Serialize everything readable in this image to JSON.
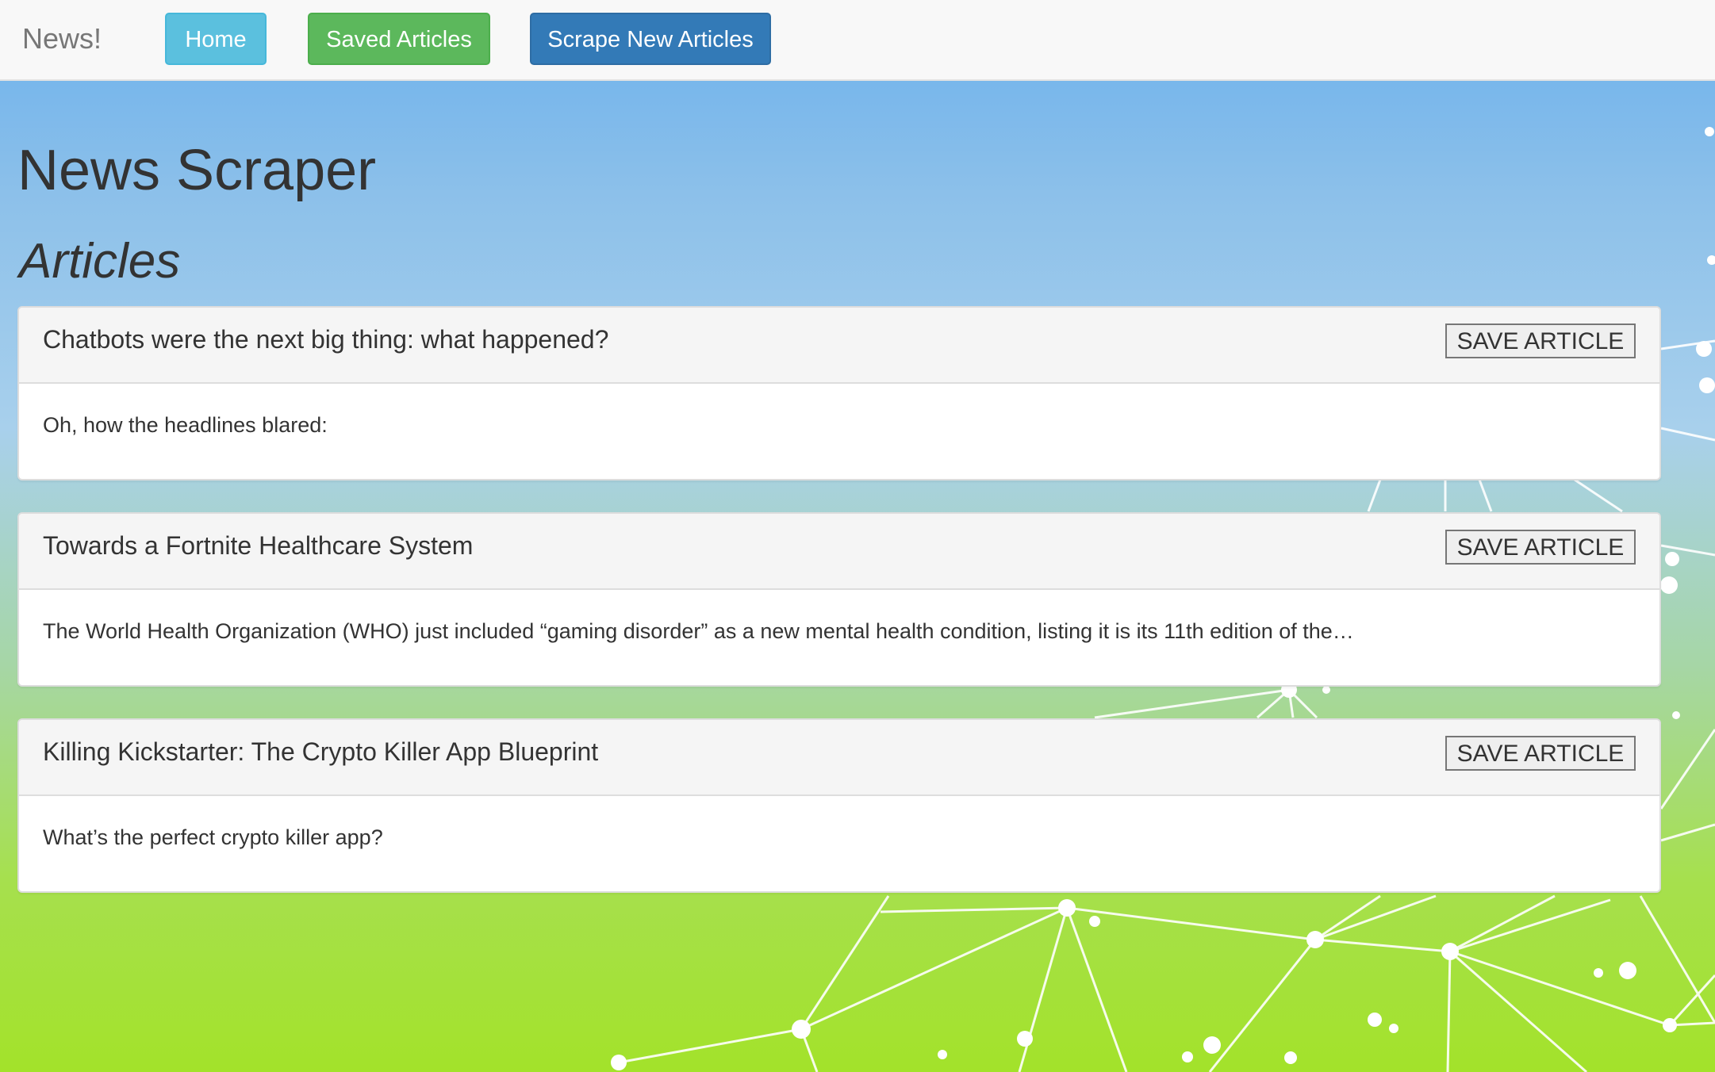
{
  "navbar": {
    "brand": "News!",
    "buttons": [
      {
        "label": "Home"
      },
      {
        "label": "Saved Articles"
      },
      {
        "label": "Scrape New Articles"
      }
    ]
  },
  "page": {
    "title": "News Scraper",
    "section_title": "Articles"
  },
  "articles": [
    {
      "title": "Chatbots were the next big thing: what happened?",
      "summary": "Oh, how the headlines blared:",
      "save_label": "SAVE ARTICLE"
    },
    {
      "title": "Towards a Fortnite Healthcare System",
      "summary": "The World Health Organization (WHO) just included “gaming disorder” as a new mental health condition, listing it is its 11th edition of the…",
      "save_label": "SAVE ARTICLE"
    },
    {
      "title": "Killing Kickstarter: The Crypto Killer App Blueprint",
      "summary": "What’s the perfect crypto killer app?",
      "save_label": "SAVE ARTICLE"
    }
  ],
  "colors": {
    "home_button": "#5bc0de",
    "saved_button": "#5cb85c",
    "scrape_button": "#337ab7",
    "background_top": "#6ab0ec",
    "background_bottom": "#a3e22a"
  }
}
